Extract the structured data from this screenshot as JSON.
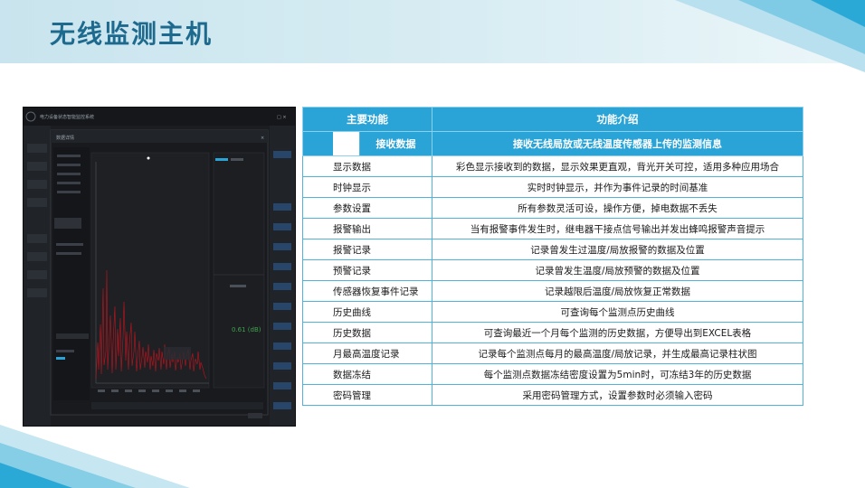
{
  "page": {
    "title": "无线监测主机"
  },
  "table": {
    "header": {
      "col1": "主要功能",
      "col2": "功能介绍"
    },
    "subheader": {
      "col1": "接收数据",
      "col2": "接收无线局放或无线温度传感器上传的监测信息"
    },
    "rows": [
      {
        "name": "显示数据",
        "desc": "彩色显示接收到的数据，显示效果更直观，背光开关可控，适用多种应用场合"
      },
      {
        "name": "时钟显示",
        "desc": "实时时钟显示，并作为事件记录的时间基准"
      },
      {
        "name": "参数设置",
        "desc": "所有参数灵活可设，操作方便，掉电数据不丢失"
      },
      {
        "name": "报警输出",
        "desc": "当有报警事件发生时，继电器干接点信号输出并发出蜂鸣报警声音提示"
      },
      {
        "name": "报警记录",
        "desc": "记录曾发生过温度/局放报警的数据及位置"
      },
      {
        "name": "预警记录",
        "desc": "记录曾发生温度/局放预警的数据及位置"
      },
      {
        "name": "传感器恢复事件记录",
        "desc": "记录越限后温度/局放恢复正常数据"
      },
      {
        "name": "历史曲线",
        "desc": "可查询每个监测点历史曲线"
      },
      {
        "name": "历史数据",
        "desc": "可查询最近一个月每个监测的历史数据，方便导出到EXCEL表格"
      },
      {
        "name": "月最高温度记录",
        "desc": "记录每个监测点每月的最高温度/局放记录，并生成最高记录柱状图"
      },
      {
        "name": "数据冻结",
        "desc": "每个监测点数据冻结密度设置为5min时，可冻结3年的历史数据"
      },
      {
        "name": "密码管理",
        "desc": "采用密码管理方式，设置参数时必须输入密码"
      }
    ]
  },
  "screenshot": {
    "app_title": "电力设备状态智能监控系统",
    "dialog_title": "数据详情",
    "panel_value": "0.61 (dB)",
    "colors": {
      "series": "#c0141e",
      "accent": "#2aa3d7",
      "value": "#3fa34d"
    }
  }
}
